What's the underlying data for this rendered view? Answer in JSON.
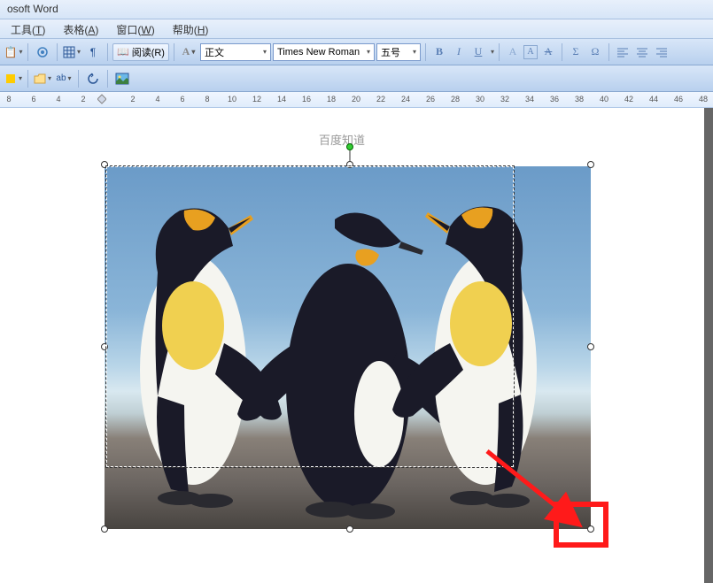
{
  "app_title": "osoft Word",
  "menu": {
    "tools": {
      "label": "工具(T)",
      "letter": "T"
    },
    "table": {
      "label": "表格(A)",
      "letter": "A"
    },
    "window": {
      "label": "窗口(W)",
      "letter": "W"
    },
    "help": {
      "label": "帮助(H)",
      "letter": "H"
    }
  },
  "toolbar": {
    "read_label": "阅读(R)",
    "style_label": "正文",
    "font_label": "Times New Roman",
    "fontsize_label": "五号"
  },
  "fmt": {
    "bold": "B",
    "italic": "I",
    "underline": "U",
    "align_center": "A",
    "font_shadow": "A"
  },
  "ruler": {
    "marks": [
      "8",
      "6",
      "4",
      "2",
      "",
      "2",
      "4",
      "6",
      "8",
      "10",
      "12",
      "14",
      "16",
      "18",
      "20",
      "22",
      "24",
      "26",
      "28",
      "30",
      "32",
      "34",
      "36",
      "38",
      "40",
      "42",
      "44",
      "46",
      "48"
    ]
  },
  "watermark": "百度知道",
  "annotation": {
    "arrow_color": "#ff1a1a"
  }
}
